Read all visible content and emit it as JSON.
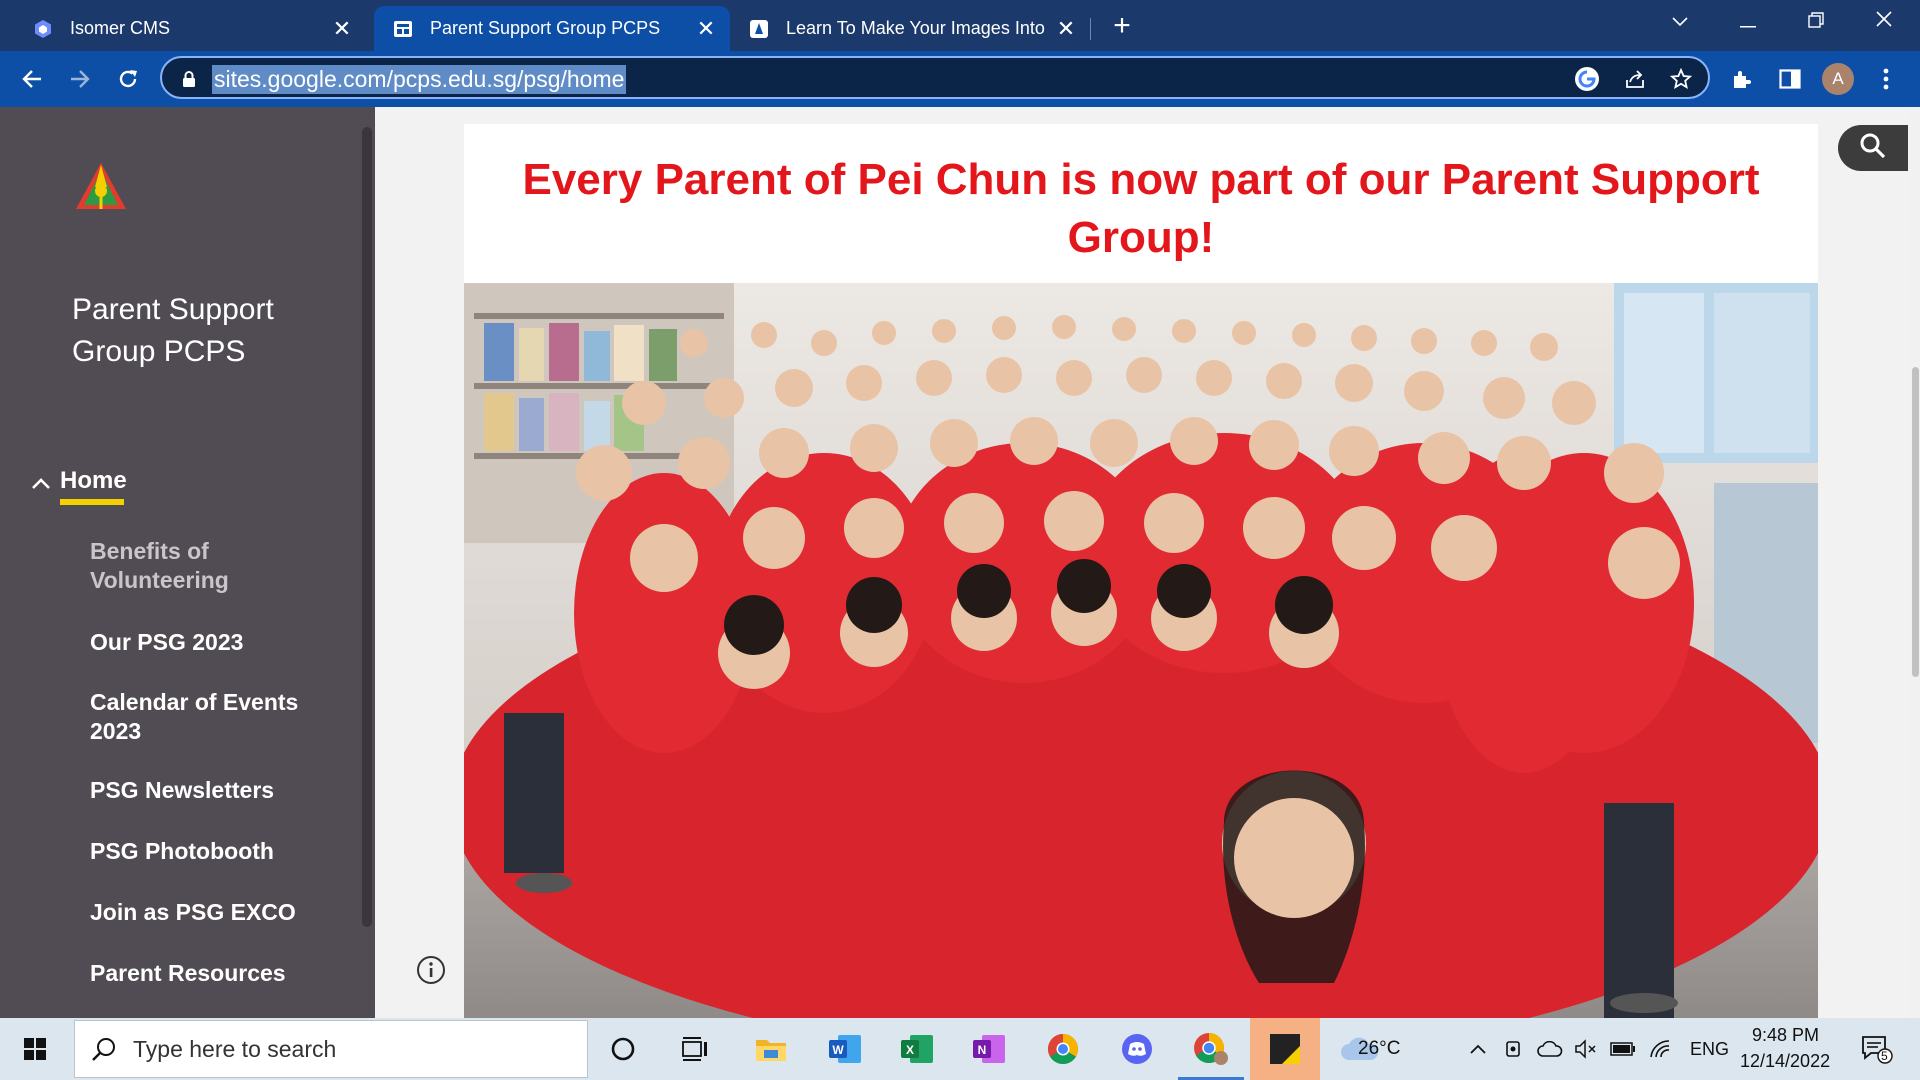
{
  "browser": {
    "tabs": [
      {
        "title": "Isomer CMS",
        "active": false
      },
      {
        "title": "Parent Support Group PCPS",
        "active": true
      },
      {
        "title": "Learn To Make Your Images Into",
        "active": false
      }
    ],
    "url": "sites.google.com/pcps.edu.sg/psg/home",
    "profile_initial": "A",
    "accent": "#0d4fa6"
  },
  "sidebar": {
    "site_title": "Parent Support Group PCPS",
    "home_label": "Home",
    "items": [
      {
        "label": "Benefits of Volunteering"
      },
      {
        "label": "Our PSG 2023"
      },
      {
        "label": "Calendar of Events 2023"
      },
      {
        "label": "PSG Newsletters"
      },
      {
        "label": "PSG Photobooth"
      },
      {
        "label": "Join as PSG EXCO"
      },
      {
        "label": "Parent Resources"
      }
    ]
  },
  "main": {
    "headline": "Every Parent of Pei Chun is now part of our Parent Support Group!",
    "headline_color": "#e3161b",
    "photo_icon": "group-photo"
  },
  "taskbar": {
    "search_placeholder": "Type here to search",
    "weather": "26°C",
    "language": "ENG",
    "time": "9:48 PM",
    "date": "12/14/2022",
    "notification_count": "5"
  }
}
